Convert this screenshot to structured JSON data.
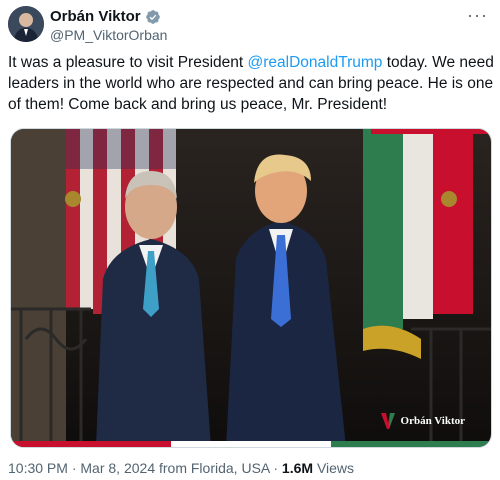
{
  "author": {
    "display_name": "Orbán Viktor",
    "handle": "@PM_ViktorOrban",
    "verified_icon": "verified-badge-icon"
  },
  "tweet": {
    "text_before": "It was a pleasure to visit President ",
    "mention": "@realDonaldTrump",
    "text_after": " today. We need leaders in the world who are respected and can bring peace. He is one of them! Come back and bring us peace, Mr. President!"
  },
  "media": {
    "watermark": "Orbán Viktor",
    "colors": {
      "flag_red": "#c8102e",
      "flag_green": "#2e7d4f",
      "suit": "#1f2b45"
    }
  },
  "meta": {
    "time": "10:30 PM",
    "separator": "·",
    "date_location": "Mar 8, 2024 from Florida, USA",
    "views_count": "1.6M",
    "views_label": "Views"
  },
  "colors": {
    "link": "#1d9bf0",
    "secondary_text": "#536471",
    "verified": "#829aab"
  }
}
